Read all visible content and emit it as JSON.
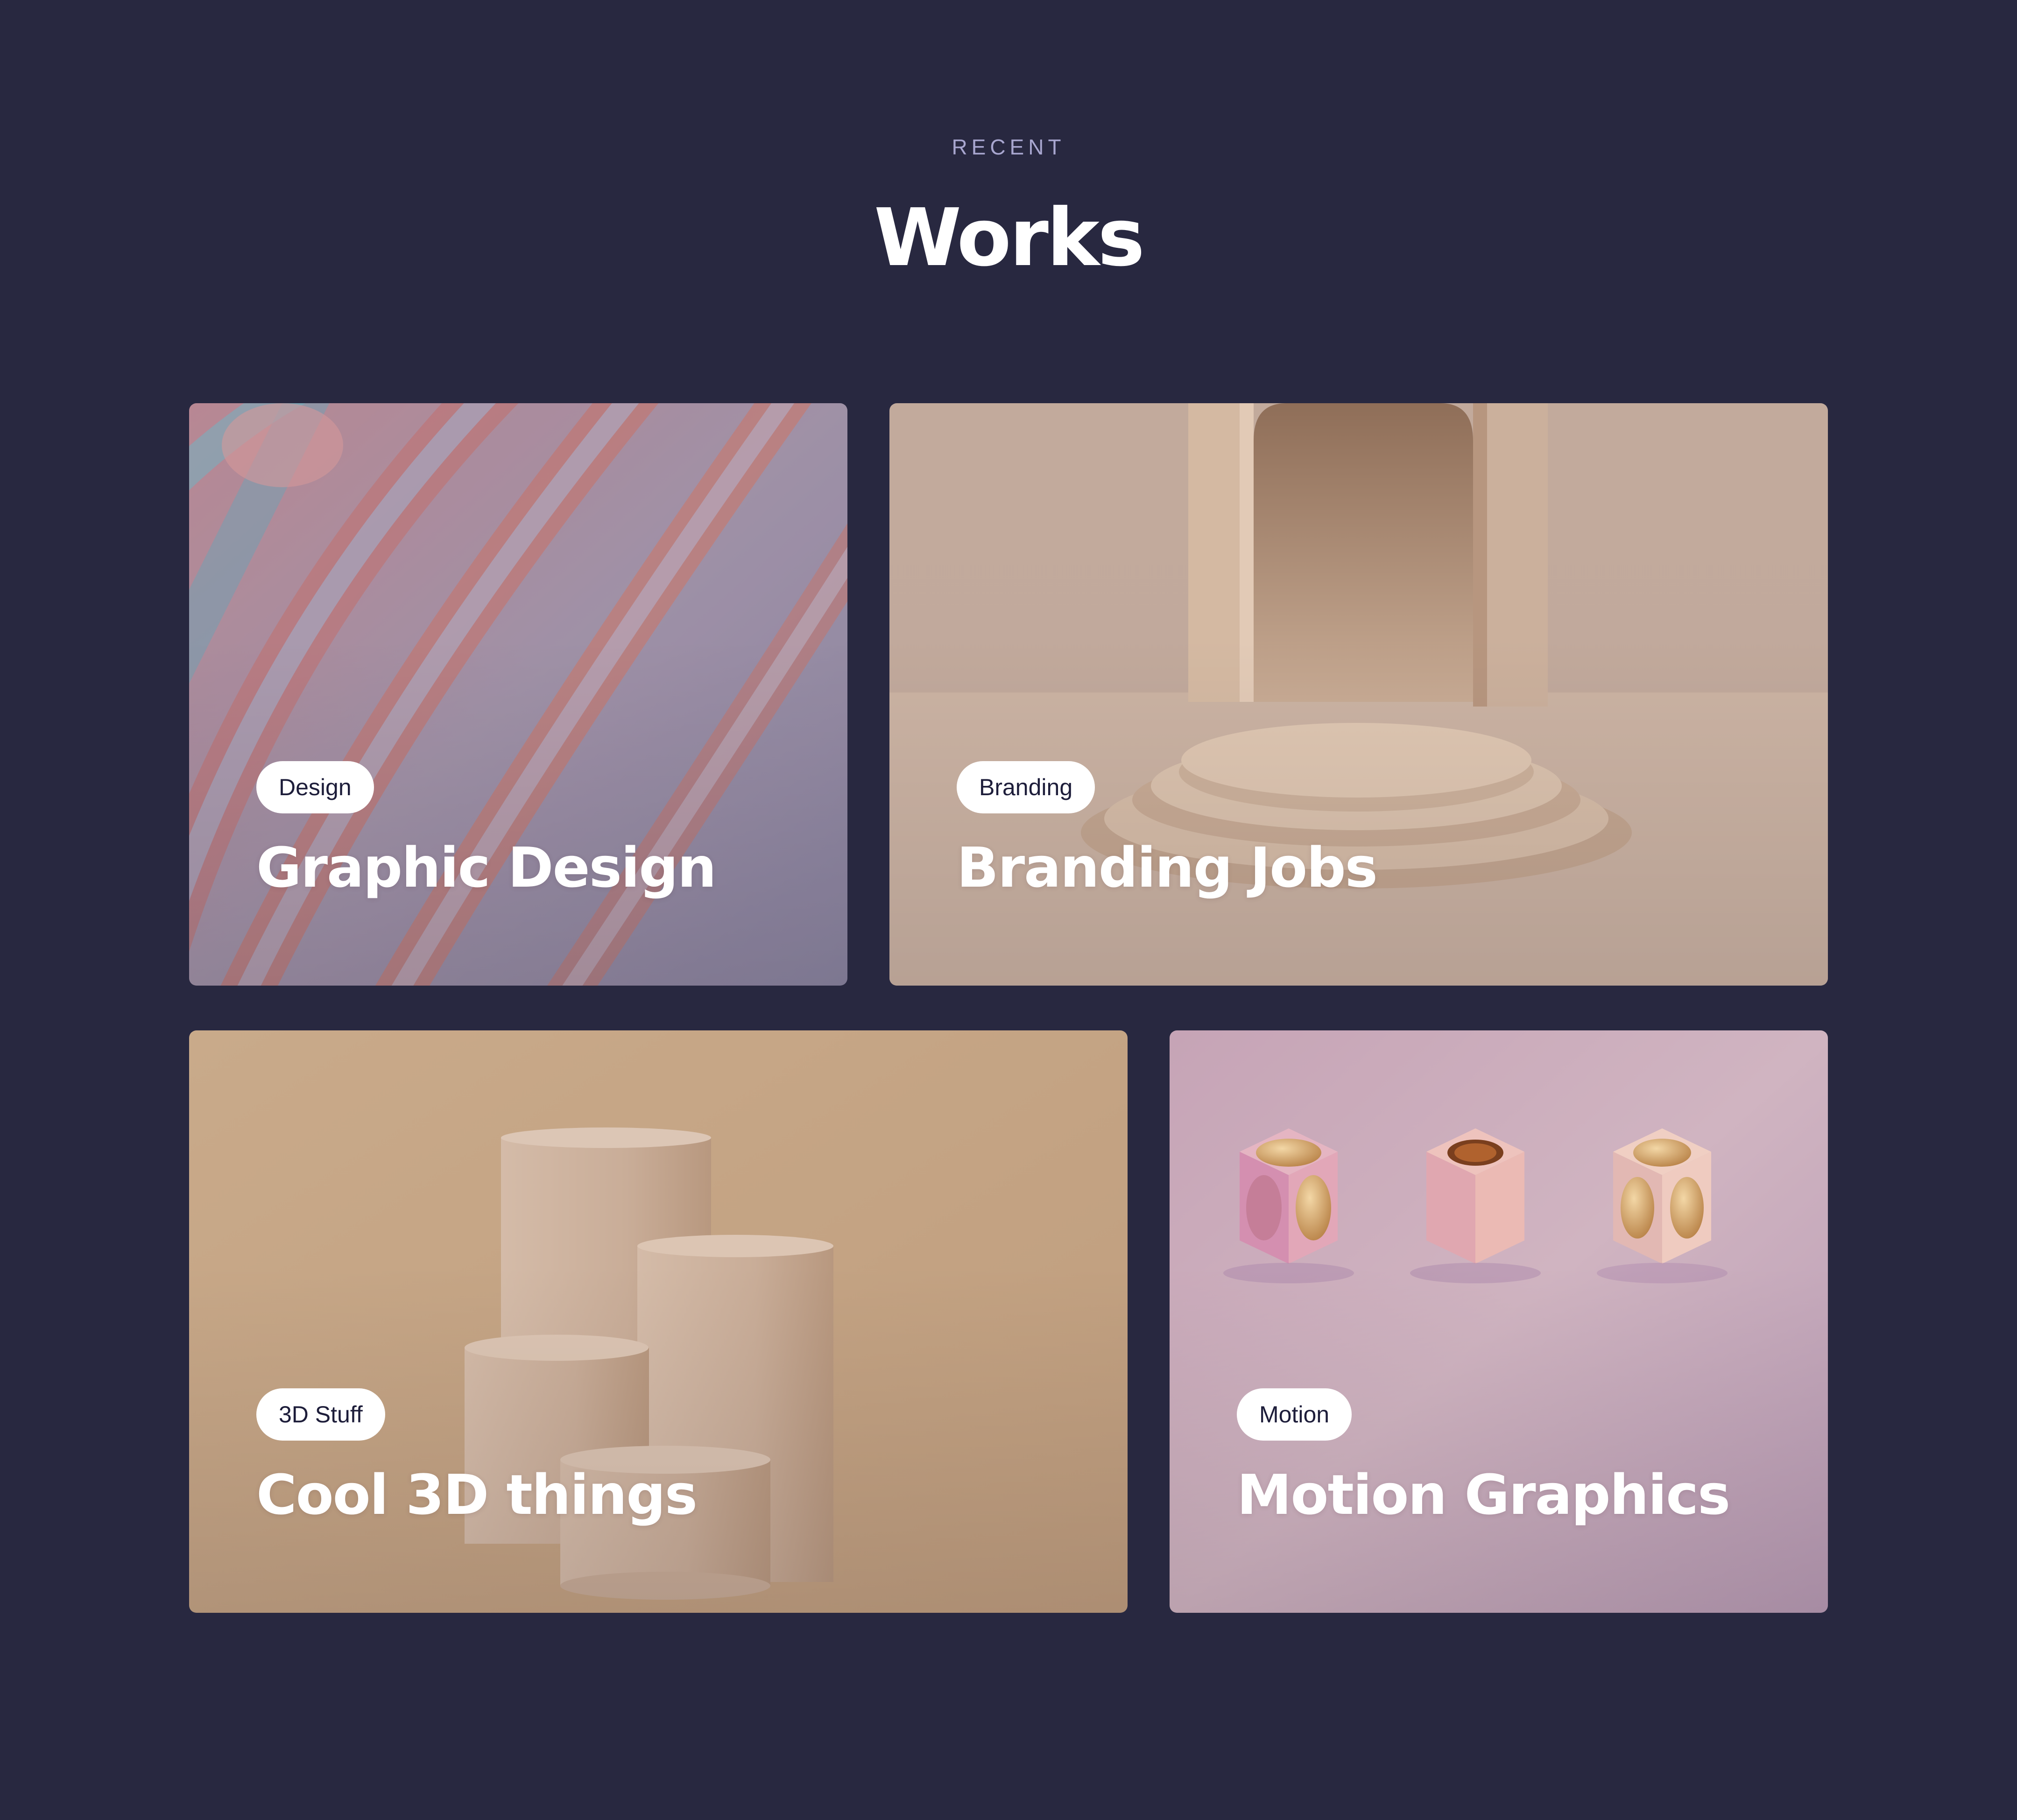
{
  "section": {
    "eyebrow": "RECENT",
    "title": "Works"
  },
  "cards": [
    {
      "tag": "Design",
      "title": "Graphic Design",
      "image": "abstract-waves-image"
    },
    {
      "tag": "Branding",
      "title": "Branding Jobs",
      "image": "archway-podium-image"
    },
    {
      "tag": "3D Stuff",
      "title": "Cool 3D things",
      "image": "cylinders-image"
    },
    {
      "tag": "Motion",
      "title": "Motion Graphics",
      "image": "cubes-spheres-image"
    }
  ],
  "colors": {
    "background": "#282840",
    "eyebrow": "#a8a6cf",
    "title": "#ffffff",
    "tag_background": "#ffffff",
    "tag_text": "#1d1d3a"
  }
}
